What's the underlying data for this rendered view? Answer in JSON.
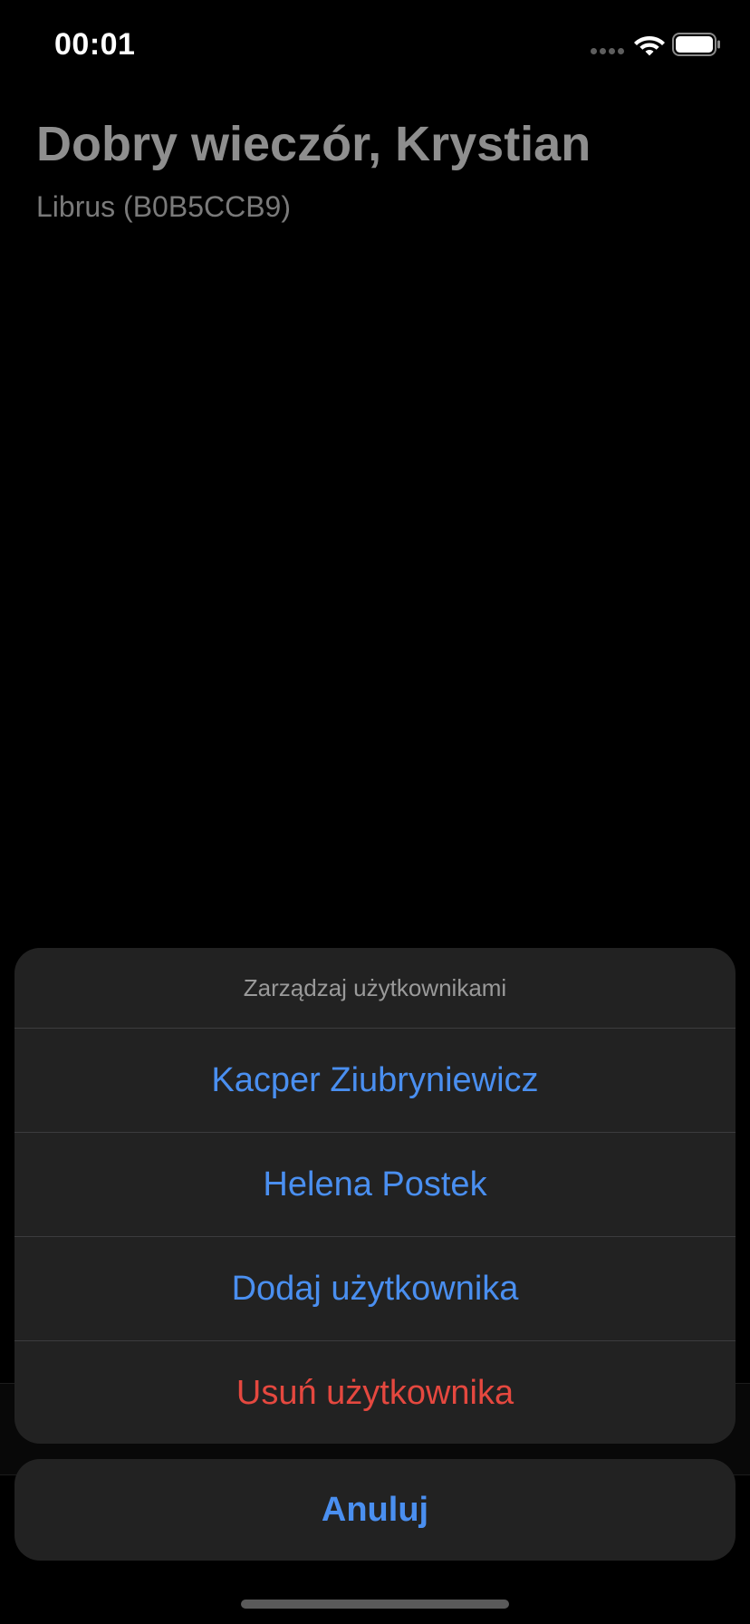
{
  "status_bar": {
    "time": "00:01"
  },
  "header": {
    "greeting": "Dobry wieczór, Krystian",
    "subtitle": "Librus (B0B5CCB9)"
  },
  "action_sheet": {
    "title": "Zarządzaj użytkownikami",
    "items": [
      {
        "label": "Kacper Ziubryniewicz"
      },
      {
        "label": "Helena Postek"
      },
      {
        "label": "Dodaj użytkownika"
      },
      {
        "label": "Usuń użytkownika"
      }
    ],
    "cancel_label": "Anuluj"
  },
  "colors": {
    "accent": "#4a8ff0",
    "destructive": "#e5483f",
    "sheet_background": "#222222"
  }
}
